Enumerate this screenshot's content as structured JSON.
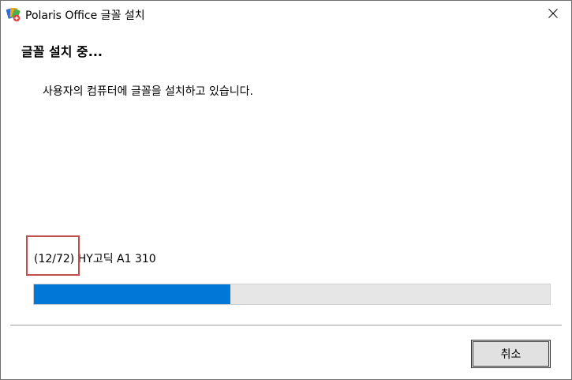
{
  "window": {
    "title": "Polaris Office 글꼴 설치",
    "icon": "polaris-office-icon",
    "close_icon": "close-icon"
  },
  "main": {
    "heading": "글꼴 설치 중...",
    "description": "사용자의 컴퓨터에 글꼴을 설치하고 있습니다."
  },
  "progress": {
    "count": "(12/72)",
    "font_name": "HY고딕 A1 310",
    "fraction": 0.381,
    "fill_color": "#0078d7",
    "track_color": "#e6e6e6"
  },
  "annotation": {
    "highlight_color": "#c0504d"
  },
  "buttons": {
    "cancel_label": "취소"
  }
}
